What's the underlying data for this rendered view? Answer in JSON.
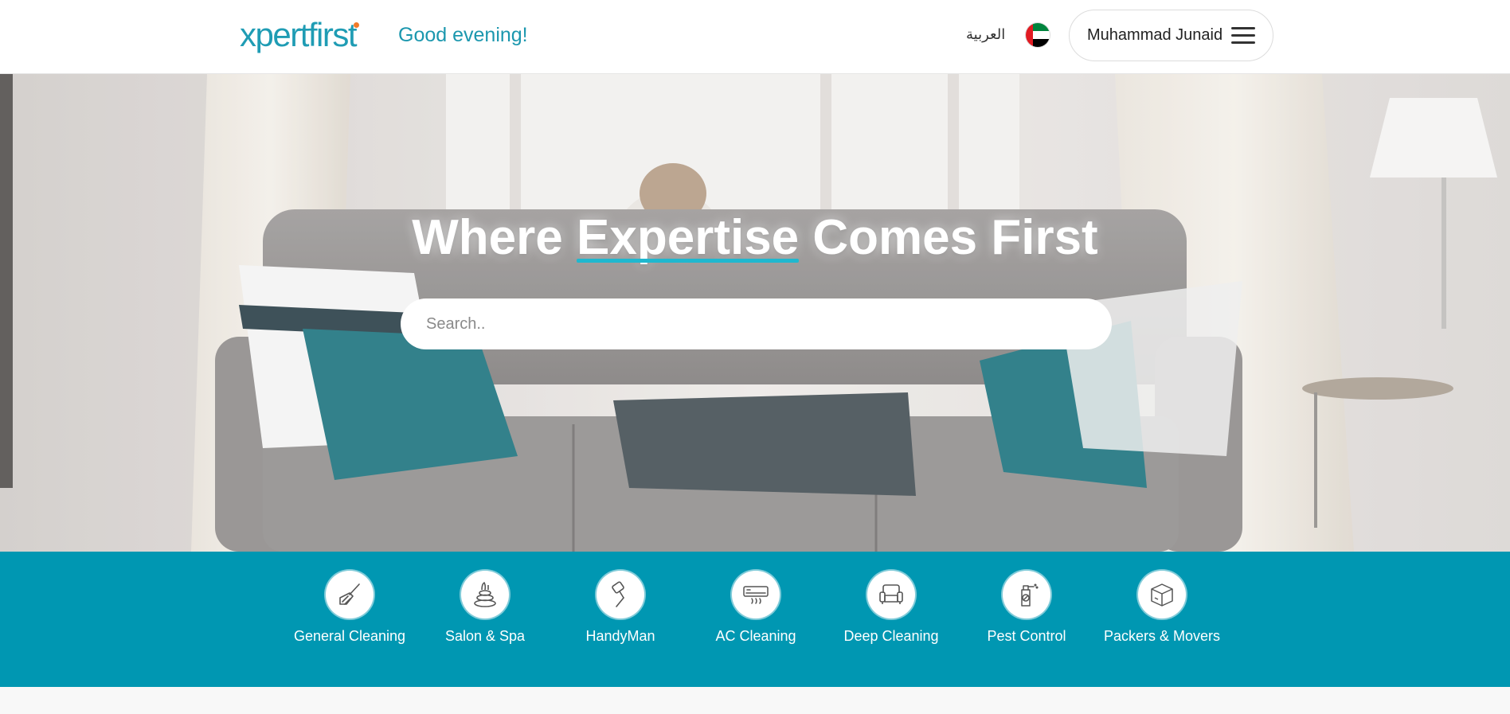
{
  "header": {
    "logo_text": "xpertfirst",
    "greeting": "Good evening!",
    "language_link": "العربية",
    "flag": "uae-flag-icon",
    "user_name": "Muhammad Junaid",
    "menu_icon": "hamburger-menu-icon"
  },
  "hero": {
    "title_before": "Where ",
    "title_highlight": "Expertise",
    "title_after": " Comes First",
    "search_placeholder": "Search.."
  },
  "categories": [
    {
      "label": "General Cleaning",
      "icon": "broom-icon"
    },
    {
      "label": "Salon & Spa",
      "icon": "spa-stones-icon"
    },
    {
      "label": "HandyMan",
      "icon": "paint-roller-icon"
    },
    {
      "label": "AC Cleaning",
      "icon": "air-conditioner-icon"
    },
    {
      "label": "Deep Cleaning",
      "icon": "sofa-icon"
    },
    {
      "label": "Pest Control",
      "icon": "pest-spray-icon"
    },
    {
      "label": "Packers & Movers",
      "icon": "box-icon"
    }
  ],
  "colors": {
    "brand": "#1f9cb4",
    "category_bar": "#0097b2",
    "logo_dot": "#f27b2a"
  }
}
